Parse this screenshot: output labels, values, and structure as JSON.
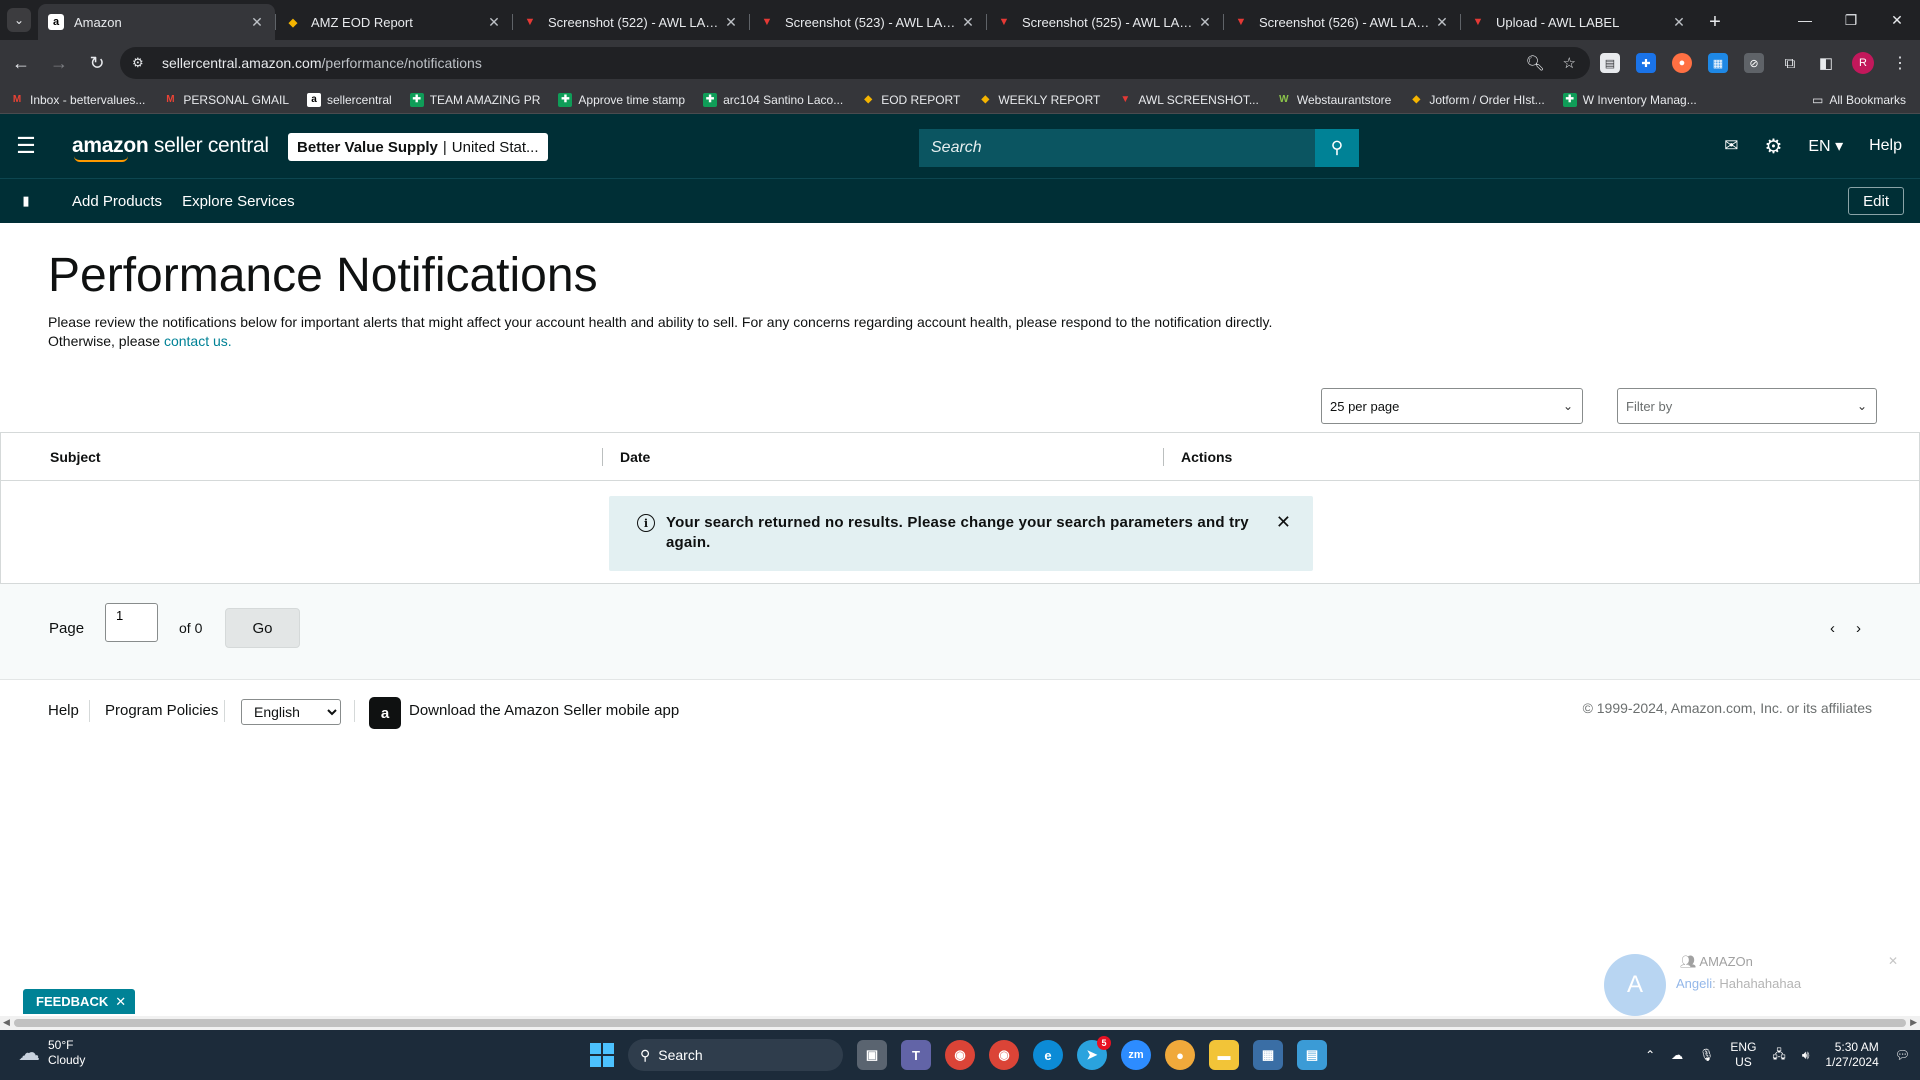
{
  "browser": {
    "tabs": [
      {
        "title": "Amazon",
        "favicon": "amazon-favicon",
        "active": true
      },
      {
        "title": "AMZ EOD Report",
        "favicon": "jotform-favicon",
        "active": false
      },
      {
        "title": "Screenshot (522) - AWL LABEL",
        "favicon": "awl-favicon",
        "active": false
      },
      {
        "title": "Screenshot (523) - AWL LABEL",
        "favicon": "awl-favicon",
        "active": false
      },
      {
        "title": "Screenshot (525) - AWL LABEL",
        "favicon": "awl-favicon",
        "active": false
      },
      {
        "title": "Screenshot (526) - AWL LABEL",
        "favicon": "awl-favicon",
        "active": false
      },
      {
        "title": "Upload - AWL LABEL",
        "favicon": "awl-favicon",
        "active": false
      }
    ],
    "url_host": "sellercentral.amazon.com",
    "url_path": "/performance/notifications",
    "profile_initial": "R",
    "bookmarks": [
      {
        "label": "Inbox - bettervalues...",
        "icon": "gmail-icon"
      },
      {
        "label": "PERSONAL GMAIL",
        "icon": "gmail-icon"
      },
      {
        "label": "sellercentral",
        "icon": "amazon-icon"
      },
      {
        "label": "TEAM AMAZING PR",
        "icon": "sheets-icon"
      },
      {
        "label": "Approve time stamp",
        "icon": "sheets-icon"
      },
      {
        "label": "arc104 Santino Laco...",
        "icon": "sheets-icon"
      },
      {
        "label": "EOD REPORT",
        "icon": "jotform-icon"
      },
      {
        "label": "WEEKLY REPORT",
        "icon": "jotform-icon"
      },
      {
        "label": "AWL SCREENSHOT...",
        "icon": "awl-icon"
      },
      {
        "label": "Webstaurantstore",
        "icon": "webstaurant-icon"
      },
      {
        "label": "Jotform / Order HIst...",
        "icon": "jotform-icon"
      },
      {
        "label": "W Inventory Manag...",
        "icon": "sheets-icon"
      }
    ],
    "all_bookmarks": "All Bookmarks"
  },
  "header": {
    "logo_bold": "amazon",
    "logo_rest": " seller central",
    "store_name": "Better Value Supply",
    "store_sep": "|",
    "store_region": "United Stat...",
    "search_placeholder": "Search",
    "language": "EN",
    "help": "Help",
    "brand_color": "#002f36",
    "accent_color": "#008296"
  },
  "nav": {
    "links": [
      "Add Products",
      "Explore Services"
    ],
    "edit_label": "Edit"
  },
  "main": {
    "title": "Performance Notifications",
    "intro_text": "Please review the notifications below for important alerts that might affect your account health and ability to sell. For any concerns regarding account health, please respond to the notification directly. Otherwise, please ",
    "intro_link": "contact us.",
    "per_page": "25 per page",
    "filter_placeholder": "Filter by",
    "columns": [
      "Subject",
      "Date",
      "Actions"
    ],
    "alert_message": "Your search returned no results. Please change your search parameters and try again."
  },
  "pagination": {
    "page_label": "Page",
    "current_page": "1",
    "of_label": "of 0",
    "go_label": "Go"
  },
  "footer": {
    "help": "Help",
    "program_policies": "Program Policies",
    "language": "English",
    "app_link": "Download the Amazon Seller mobile app",
    "copyright": "© 1999-2024, Amazon.com, Inc. or its affiliates"
  },
  "feedback": {
    "label": "FEEDBACK"
  },
  "chat": {
    "avatar_letter": "A",
    "group_name": "AMAZOn",
    "sender": "Angeli",
    "message": "Hahahahahaa"
  },
  "taskbar": {
    "temperature": "50°F",
    "condition": "Cloudy",
    "search_label": "Search",
    "lang_top": "ENG",
    "lang_bottom": "US",
    "time": "5:30 AM",
    "date": "1/27/2024",
    "telegram_badge": "5"
  }
}
